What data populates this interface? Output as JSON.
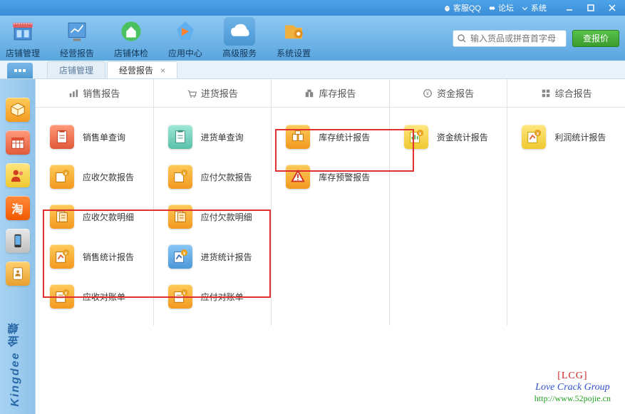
{
  "titlebar": {
    "qq": "客服QQ",
    "forum": "论坛",
    "system": "系统"
  },
  "toolbar": {
    "items": [
      "店铺管理",
      "经营报告",
      "店铺体检",
      "应用中心",
      "高级服务",
      "系统设置"
    ],
    "search_placeholder": "输入货品或拼音首字母",
    "price_btn": "查报价"
  },
  "tabs": {
    "t1": "店铺管理",
    "t2": "经营报告"
  },
  "categories": [
    "销售报告",
    "进货报告",
    "库存报告",
    "资金报告",
    "综合报告"
  ],
  "reports": {
    "c1": [
      "销售单查询",
      "应收欠款报告",
      "应收欠款明细",
      "销售统计报告",
      "应收对账单"
    ],
    "c2": [
      "进货单查询",
      "应付欠款报告",
      "应付欠款明细",
      "进货统计报告",
      "应付对账单"
    ],
    "c3": [
      "库存统计报告",
      "库存预警报告"
    ],
    "c4": [
      "资金统计报告"
    ],
    "c5": [
      "利润统计报告"
    ]
  },
  "watermark": {
    "tag": "[LCG]",
    "full": "Love Crack Group",
    "url": "http://www.52pojie.cn"
  },
  "brand": "Kingdee 金蝶"
}
